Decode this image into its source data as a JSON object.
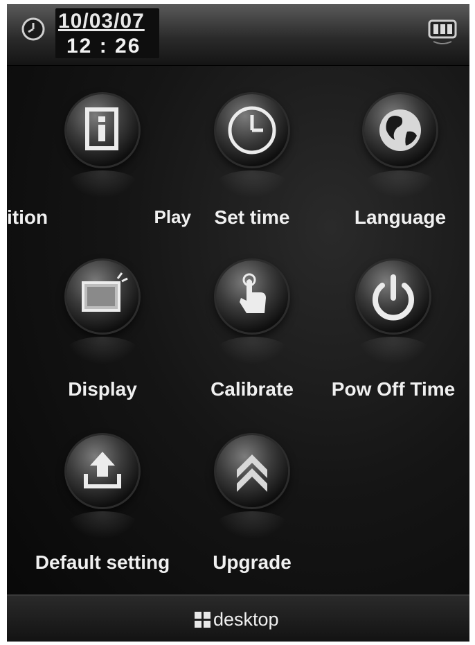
{
  "status": {
    "date": "10/03/07",
    "time": "12 : 26",
    "clock_icon": "clock-icon",
    "battery_icon": "battery-icon"
  },
  "menu": {
    "items": [
      {
        "label": "Play",
        "partial_label": "ition",
        "icon": "info-icon"
      },
      {
        "label": "Set time",
        "icon": "clock-icon"
      },
      {
        "label": "Language",
        "icon": "globe-icon"
      },
      {
        "label": "Display",
        "icon": "monitor-icon"
      },
      {
        "label": "Calibrate",
        "icon": "touch-hand-icon"
      },
      {
        "label": "Pow Off Time",
        "icon": "power-icon"
      },
      {
        "label": "Default setting",
        "icon": "upload-icon"
      },
      {
        "label": "Upgrade",
        "icon": "double-chevron-up-icon"
      }
    ]
  },
  "footer": {
    "desktop_label": "desktop",
    "desktop_icon": "grid-icon"
  }
}
